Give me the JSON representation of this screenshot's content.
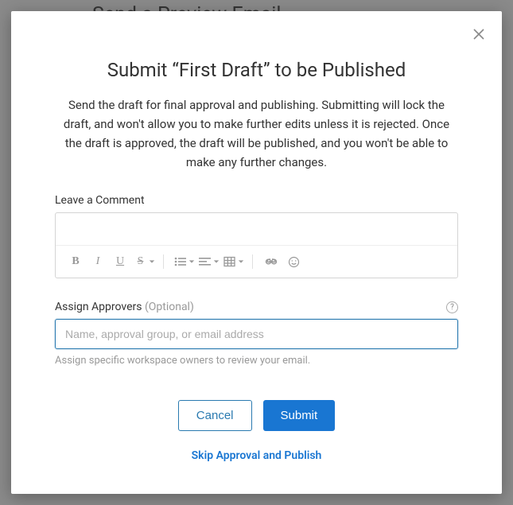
{
  "backdrop": {
    "heading": "Send a Preview Email"
  },
  "modal": {
    "title": "Submit “First Draft” to be Published",
    "description": "Send the draft for final approval and publishing. Submitting will lock the draft, and won't allow you to make further edits unless it is rejected. Once the draft is approved, the draft will be published, and you won't be able to make any further changes.",
    "comment": {
      "label": "Leave a Comment",
      "value": ""
    },
    "toolbar": {
      "bold": "B",
      "italic": "I",
      "underline": "U",
      "strike": "S"
    },
    "approvers": {
      "label": "Assign Approvers",
      "optional": " (Optional)",
      "placeholder": "Name, approval group, or email address",
      "hint": "Assign specific workspace owners to review your email.",
      "help": "?"
    },
    "buttons": {
      "cancel": "Cancel",
      "submit": "Submit"
    },
    "skip": "Skip Approval and Publish"
  }
}
